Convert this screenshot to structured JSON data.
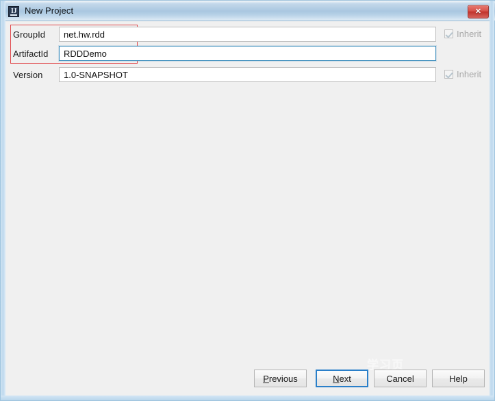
{
  "window": {
    "title": "New Project",
    "icon": "intellij-idea-icon",
    "close_label": "✕",
    "accent_blue": "#2a7fc9",
    "annotation_color": "#e0484b",
    "titlebar_color": "#a9c7e0",
    "background": "#f0f0f0"
  },
  "form": {
    "rows": [
      {
        "label": "GroupId",
        "value": "net.hw.rdd",
        "placeholder": "",
        "focused": false,
        "inherit": {
          "label": "Inherit",
          "checked": true,
          "enabled": false,
          "visible": true
        }
      },
      {
        "label": "ArtifactId",
        "value": "RDDDemo",
        "placeholder": "",
        "focused": true,
        "inherit": {
          "label": "",
          "checked": false,
          "enabled": false,
          "visible": false
        }
      },
      {
        "label": "Version",
        "value": "1.0-SNAPSHOT",
        "placeholder": "",
        "focused": false,
        "inherit": {
          "label": "Inherit",
          "checked": true,
          "enabled": false,
          "visible": true
        }
      }
    ]
  },
  "buttons": {
    "previous": {
      "label": "Previous",
      "mnemonic": "P",
      "default": false
    },
    "next": {
      "label": "Next",
      "mnemonic": "N",
      "default": true
    },
    "cancel": {
      "label": "Cancel",
      "mnemonic": "",
      "default": false
    },
    "help": {
      "label": "Help",
      "mnemonic": "",
      "default": false
    }
  },
  "watermark": {
    "text": "学习页"
  }
}
